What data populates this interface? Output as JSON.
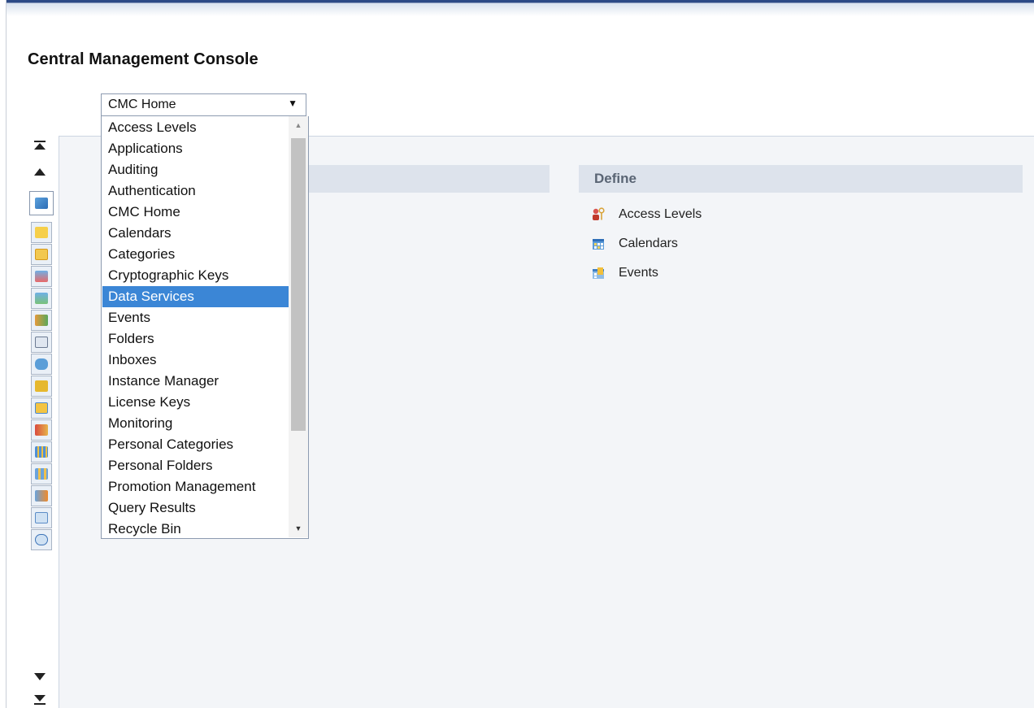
{
  "app": {
    "title": "Central Management Console"
  },
  "select": {
    "value": "CMC Home",
    "options": [
      "Access Levels",
      "Applications",
      "Auditing",
      "Authentication",
      "CMC Home",
      "Calendars",
      "Categories",
      "Cryptographic Keys",
      "Data Services",
      "Events",
      "Folders",
      "Inboxes",
      "Instance Manager",
      "License Keys",
      "Monitoring",
      "Personal Categories",
      "Personal Folders",
      "Promotion Management",
      "Query Results",
      "Recycle Bin"
    ],
    "highlighted": "Data Services"
  },
  "define": {
    "title": "Define",
    "items": [
      "Access Levels",
      "Calendars",
      "Events"
    ]
  },
  "colors": {
    "header_accent": "#2c4a86",
    "selection": "#3b86d6",
    "section_bar": "#dde3ec",
    "section_title": "#5a6574"
  },
  "icons": {
    "nav": [
      "scroll-to-top-icon",
      "scroll-up-icon",
      "cmc-home-icon",
      "folders-icon",
      "personal-folders-icon",
      "categories-icon",
      "personal-categories-icon",
      "users-groups-icon",
      "inboxes-icon",
      "servers-icon",
      "universes-icon",
      "connections-icon",
      "access-levels-icon",
      "calendars-icon",
      "events-icon",
      "federation-icon",
      "applications-icon",
      "license-keys-icon",
      "scroll-down-icon",
      "scroll-to-bottom-icon"
    ]
  }
}
